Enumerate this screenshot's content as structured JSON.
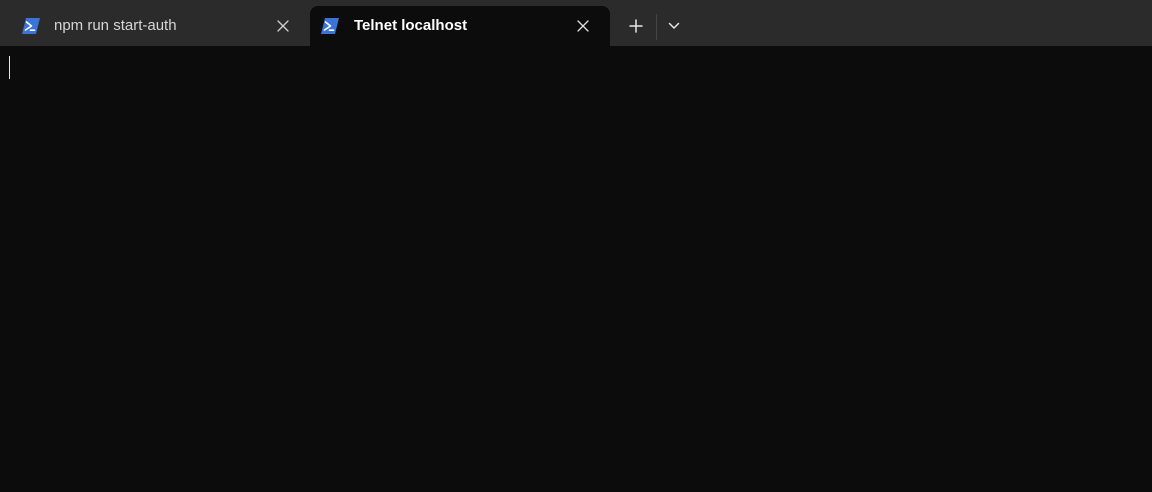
{
  "tabs": [
    {
      "title": "npm run start-auth",
      "icon": "powershell-icon",
      "active": false
    },
    {
      "title": "Telnet localhost",
      "icon": "powershell-icon",
      "active": true
    }
  ],
  "icons": {
    "close": "close-icon",
    "new_tab": "plus-icon",
    "dropdown": "chevron-down-icon"
  },
  "colors": {
    "tabbar_bg": "#2b2b2b",
    "terminal_bg": "#0c0c0c",
    "powershell_blue": "#3a74d8",
    "active_tab_text": "#ffffff",
    "inactive_tab_text": "#d6d6d6"
  },
  "terminal": {
    "content": ""
  }
}
